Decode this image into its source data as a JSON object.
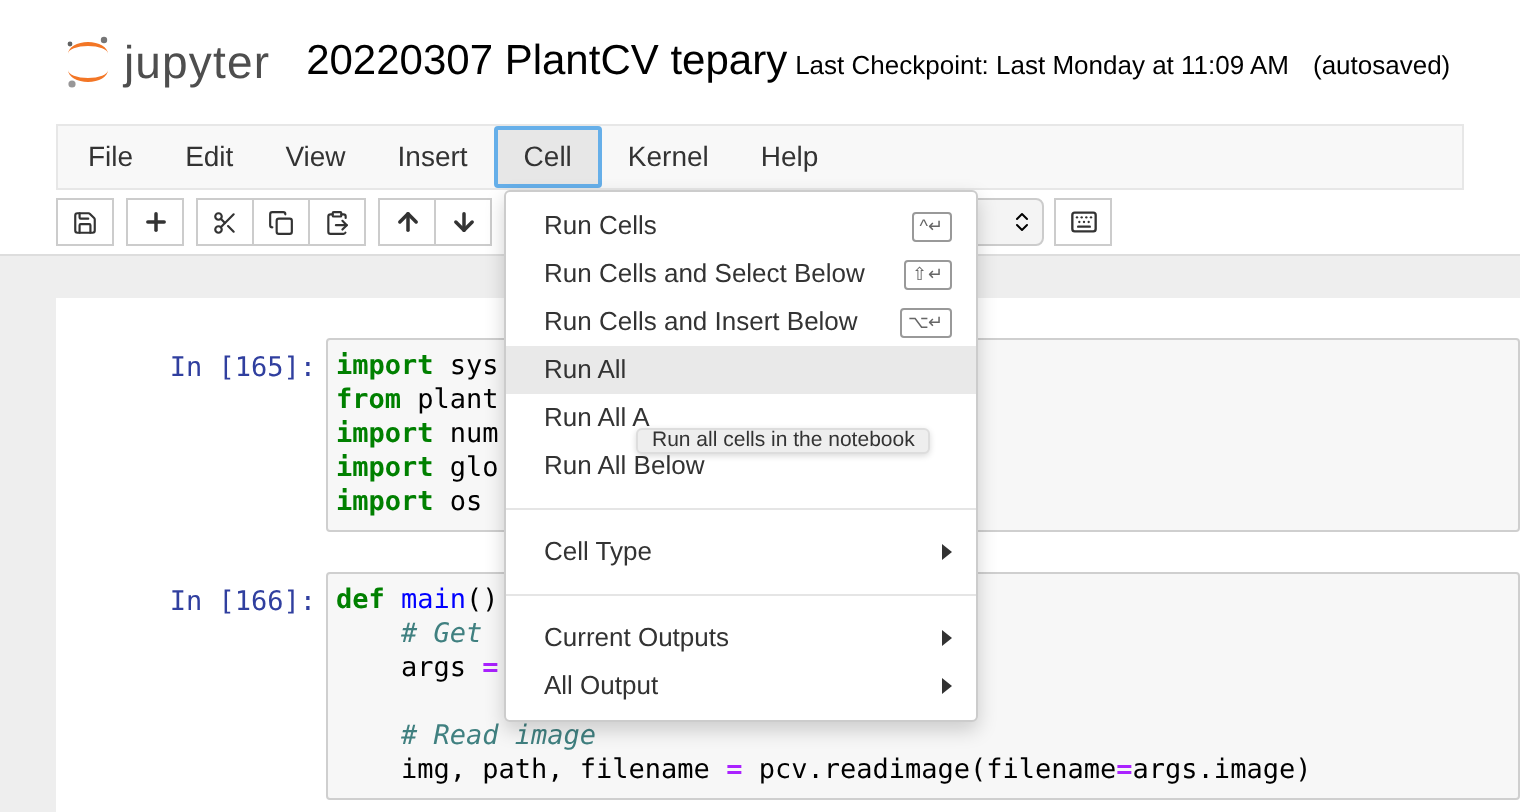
{
  "header": {
    "logo_text": "jupyter",
    "notebook_name": "20220307 PlantCV tepary",
    "checkpoint": "Last Checkpoint: Last Monday at 11:09 AM",
    "autosave": "(autosaved)"
  },
  "menubar": [
    {
      "label": "File",
      "selected": false
    },
    {
      "label": "Edit",
      "selected": false
    },
    {
      "label": "View",
      "selected": false
    },
    {
      "label": "Insert",
      "selected": false
    },
    {
      "label": "Cell",
      "selected": true
    },
    {
      "label": "Kernel",
      "selected": false
    },
    {
      "label": "Help",
      "selected": false
    }
  ],
  "cell_menu": [
    {
      "kind": "item",
      "label": "Run Cells",
      "shortcut": "^↵",
      "highlighted": false
    },
    {
      "kind": "item",
      "label": "Run Cells and Select Below",
      "shortcut": "⇧↵",
      "highlighted": false
    },
    {
      "kind": "item",
      "label": "Run Cells and Insert Below",
      "shortcut": "⌥↵",
      "highlighted": false
    },
    {
      "kind": "item",
      "label": "Run All",
      "highlighted": true
    },
    {
      "kind": "item",
      "label": "Run All A",
      "highlighted": false
    },
    {
      "kind": "item",
      "label": "Run All Below",
      "highlighted": false
    },
    {
      "kind": "divider"
    },
    {
      "kind": "submenu",
      "label": "Cell Type",
      "highlighted": false
    },
    {
      "kind": "divider"
    },
    {
      "kind": "submenu",
      "label": "Current Outputs",
      "highlighted": false
    },
    {
      "kind": "submenu",
      "label": "All Output",
      "highlighted": false
    }
  ],
  "tooltip": "Run all cells in the notebook",
  "cells": [
    {
      "prompt": "In [165]:",
      "lines": [
        [
          {
            "kind": "keyword",
            "text": "import"
          },
          {
            "kind": "plain",
            "text": " sys"
          }
        ],
        [
          {
            "kind": "keyword",
            "text": "from"
          },
          {
            "kind": "plain",
            "text": " plant"
          }
        ],
        [
          {
            "kind": "keyword",
            "text": "import"
          },
          {
            "kind": "plain",
            "text": " num"
          }
        ],
        [
          {
            "kind": "keyword",
            "text": "import"
          },
          {
            "kind": "plain",
            "text": " glo"
          }
        ],
        [
          {
            "kind": "keyword",
            "text": "import"
          },
          {
            "kind": "plain",
            "text": " os"
          }
        ]
      ]
    },
    {
      "prompt": "In [166]:",
      "lines": [
        [
          {
            "kind": "keyword",
            "text": "def"
          },
          {
            "kind": "name",
            "text": " main"
          },
          {
            "kind": "plain",
            "text": "()"
          }
        ],
        [
          {
            "kind": "comment",
            "text": "    # Get"
          }
        ],
        [
          {
            "kind": "plain",
            "text": "    args "
          },
          {
            "kind": "operator",
            "text": "="
          }
        ],
        [
          {
            "kind": "blank"
          }
        ],
        [
          {
            "kind": "comment",
            "text": "    # Read image"
          }
        ],
        [
          {
            "kind": "plain",
            "text": "    img, path, filename "
          },
          {
            "kind": "operator",
            "text": "="
          },
          {
            "kind": "plain",
            "text": " pcv.readimage(filename"
          },
          {
            "kind": "operator",
            "text": "="
          },
          {
            "kind": "plain",
            "text": "args.image)"
          }
        ]
      ]
    }
  ]
}
